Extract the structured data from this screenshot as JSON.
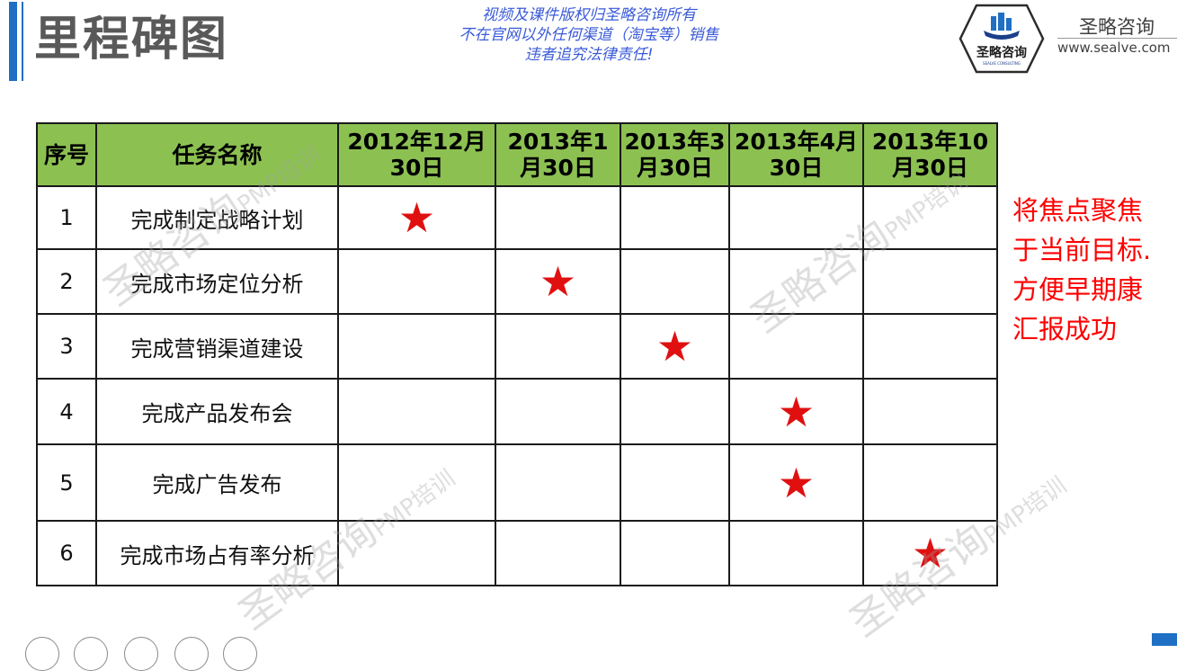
{
  "header": {
    "title": "里程碑图",
    "notice": [
      "视频及课件版权归圣略咨询所有",
      "不在官网以外任何渠道（淘宝等）销售",
      "违者追究法律责任!"
    ]
  },
  "logo": {
    "name": "圣略咨询",
    "sub": "SEALVE CONSULTING"
  },
  "brand": {
    "name": "圣略咨询",
    "url": "www.sealve.com"
  },
  "table": {
    "headers": [
      "序号",
      "任务名称",
      "2012年12月30日",
      "2013年1月30日",
      "2013年3月30日",
      "2013年4月30日",
      "2013年10月30日"
    ],
    "header_lines": [
      [
        "序号"
      ],
      [
        "任务名称"
      ],
      [
        "2012年12月",
        "30日"
      ],
      [
        "2013年1",
        "月30日"
      ],
      [
        "2013年3",
        "月30日"
      ],
      [
        "2013年4月",
        "30日"
      ],
      [
        "2013年10",
        "月30日"
      ]
    ],
    "rows": [
      {
        "no": "1",
        "task": "完成制定战略计划",
        "milestone": 0
      },
      {
        "no": "2",
        "task": "完成市场定位分析",
        "milestone": 1
      },
      {
        "no": "3",
        "task": "完成营销渠道建设",
        "milestone": 2
      },
      {
        "no": "4",
        "task": "完成产品发布会",
        "milestone": 3
      },
      {
        "no": "5",
        "task": "完成广告发布",
        "milestone": 3
      },
      {
        "no": "6",
        "task": "完成市场占有率分析",
        "milestone": 4
      }
    ],
    "marker": "★",
    "header_color": "#8cc152",
    "marker_color": "#e01010"
  },
  "callout": {
    "lines": [
      "将焦点聚焦",
      "于当前目标.",
      "方便早期康",
      "汇报成功"
    ],
    "color": "#ff0000"
  },
  "watermark": {
    "text": "圣略咨询",
    "suffix": "PMP培训"
  },
  "colors": {
    "accent": "#1f6fc5",
    "notice": "#3b5bd8"
  }
}
